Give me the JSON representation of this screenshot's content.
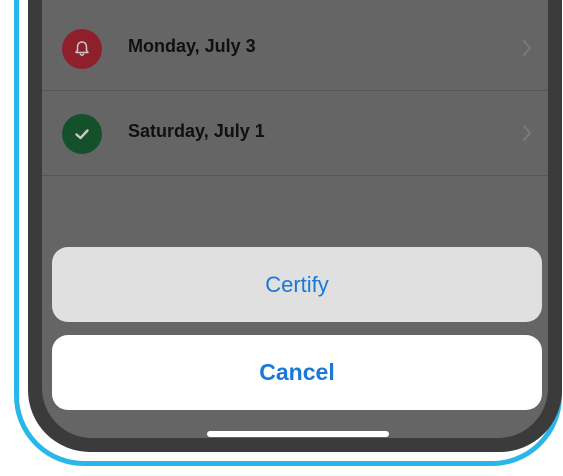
{
  "list": {
    "items": [
      {
        "label": "Monday, July 3",
        "icon": "bell-icon",
        "status_color": "#8e1f2b"
      },
      {
        "label": "Saturday, July 1",
        "icon": "checkmark-icon",
        "status_color": "#14512a"
      }
    ]
  },
  "action_sheet": {
    "certify_label": "Certify",
    "cancel_label": "Cancel"
  },
  "colors": {
    "accent": "#1a78d8",
    "frame": "#29b6e8"
  }
}
